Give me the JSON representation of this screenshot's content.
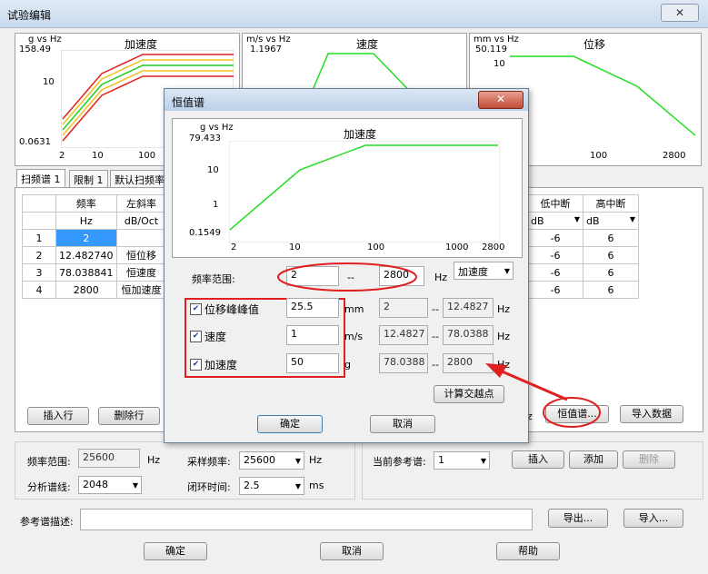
{
  "window": {
    "title": "试验编辑",
    "close": "✕"
  },
  "charts": {
    "acc": {
      "unit": "g vs Hz",
      "title": "加速度",
      "ymax": "158.49",
      "ymid": "10",
      "ymin": "0.0631",
      "x": [
        "2",
        "10",
        "100"
      ]
    },
    "vel": {
      "unit": "m/s vs Hz",
      "title": "速度",
      "ymax": "1.1967"
    },
    "disp": {
      "unit": "mm vs Hz",
      "title": "位移",
      "ymax": "50.119",
      "ymid": "10",
      "x": [
        "100",
        "2800"
      ]
    }
  },
  "tabs": [
    "扫频谱 1",
    "限制 1",
    "默认扫频率"
  ],
  "table": {
    "headers": [
      "频率",
      "左斜率"
    ],
    "units": [
      "Hz",
      "dB/Oct"
    ],
    "rows": [
      {
        "n": "1",
        "freq": "2",
        "slope": ""
      },
      {
        "n": "2",
        "freq": "12.482740",
        "slope": "恒位移"
      },
      {
        "n": "3",
        "freq": "78.038841",
        "slope": "恒速度"
      },
      {
        "n": "4",
        "freq": "2800",
        "slope": "恒加速度"
      }
    ],
    "right_headers": [
      "低中断",
      "高中断"
    ],
    "right_units": [
      "dB",
      "dB"
    ],
    "right_rows": [
      [
        "-6",
        "6"
      ],
      [
        "-6",
        "6"
      ],
      [
        "-6",
        "6"
      ],
      [
        "-6",
        "6"
      ]
    ]
  },
  "buttons": {
    "insert_row": "插入行",
    "delete_row": "删除行",
    "const_spectrum": "恒值谱...",
    "import_data": "导入数据",
    "insert": "插入",
    "add": "添加",
    "delete": "删除",
    "export": "导出...",
    "import": "导入...",
    "ok": "确定",
    "cancel": "取消",
    "help": "帮助"
  },
  "hz_fragment": "z",
  "settings": {
    "freq_range_label": "频率范围:",
    "freq_range_value": "25600",
    "hz": "Hz",
    "lines_label": "分析谱线:",
    "lines_value": "2048",
    "sample_label": "采样频率:",
    "sample_value": "25600",
    "sample_unit": "Hz",
    "loop_label": "闭环时间:",
    "loop_value": "2.5",
    "loop_unit": "ms",
    "ref_label": "当前参考谱:",
    "ref_value": "1",
    "desc_label": "参考谱描述:"
  },
  "dialog": {
    "title": "恒值谱",
    "close": "✕",
    "chart": {
      "unit": "g vs Hz",
      "title": "加速度",
      "y": [
        "79.433",
        "10",
        "1",
        "0.1549"
      ],
      "x": [
        "2",
        "10",
        "100",
        "1000",
        "2800"
      ]
    },
    "range_label": "频率范围:",
    "range_from": "2",
    "range_sep": "--",
    "range_to": "2800",
    "range_unit": "Hz",
    "type_value": "加速度",
    "rows": [
      {
        "label": "位移峰峰值",
        "value": "25.5",
        "unit": "mm",
        "from": "2",
        "to": "12.4827",
        "hz": "Hz"
      },
      {
        "label": "速度",
        "value": "1",
        "unit": "m/s",
        "from": "12.4827",
        "to": "78.0388",
        "hz": "Hz"
      },
      {
        "label": "加速度",
        "value": "50",
        "unit": "g",
        "from": "78.0388",
        "to": "2800",
        "hz": "Hz"
      }
    ],
    "sep": "--",
    "calc": "计算交越点",
    "ok": "确定",
    "cancel": "取消"
  },
  "colors": {
    "annotation_red": "#e02020",
    "curve_green": "#22dd22"
  }
}
